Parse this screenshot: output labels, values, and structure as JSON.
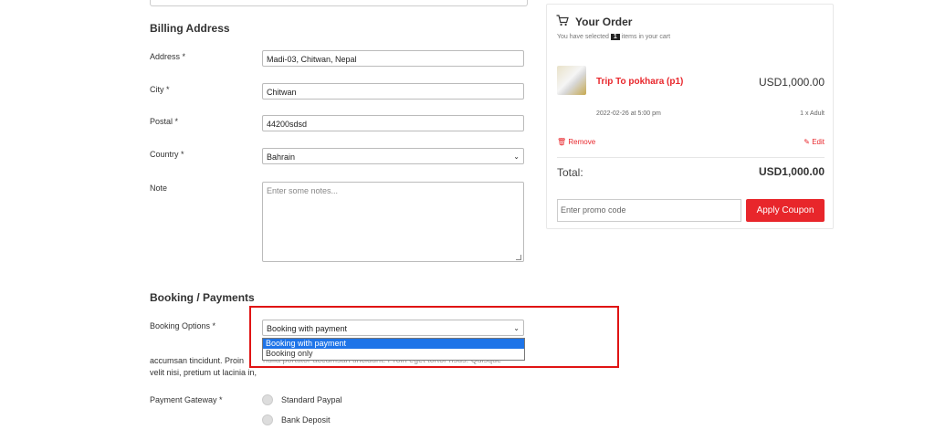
{
  "billing": {
    "title": "Billing Address",
    "address_label": "Address *",
    "address_value": "Madi-03, Chitwan, Nepal",
    "city_label": "City *",
    "city_value": "Chitwan",
    "postal_label": "Postal *",
    "postal_value": "44200sdsd",
    "country_label": "Country *",
    "country_value": "Bahrain",
    "note_label": "Note",
    "note_placeholder": "Enter some notes..."
  },
  "booking": {
    "title": "Booking / Payments",
    "options_label": "Booking Options *",
    "options_value": "Booking with payment",
    "dropdown_options": [
      "Booking with payment",
      "Booking only"
    ],
    "hidden_text_line1_left": "accumsan tincidunt. Proin",
    "hidden_text_line1_right": "nulla porttitor accumsan tincidunt. Proin eget tortor risus. Quisque",
    "hidden_text_line2": "velit nisi, pretium ut lacinia in,",
    "gateway_label": "Payment Gateway *",
    "gateways": [
      "Standard Paypal",
      "Bank Deposit"
    ]
  },
  "order": {
    "title": "Your Order",
    "selected_prefix": "You have selected",
    "selected_count": "1",
    "selected_suffix": "items in your cart",
    "item_name": "Trip To pokhara (p1)",
    "item_price": "USD1,000.00",
    "item_date": "2022-02-26 at 5:00 pm",
    "item_qty": "1 x Adult",
    "remove_label": "Remove",
    "edit_label": "Edit",
    "total_label": "Total:",
    "total_value": "USD1,000.00",
    "promo_placeholder": "Enter promo code",
    "coupon_button": "Apply Coupon"
  },
  "colors": {
    "accent": "#e8262b",
    "highlight_border": "#e01414",
    "dropdown_selected": "#1e74e8"
  }
}
